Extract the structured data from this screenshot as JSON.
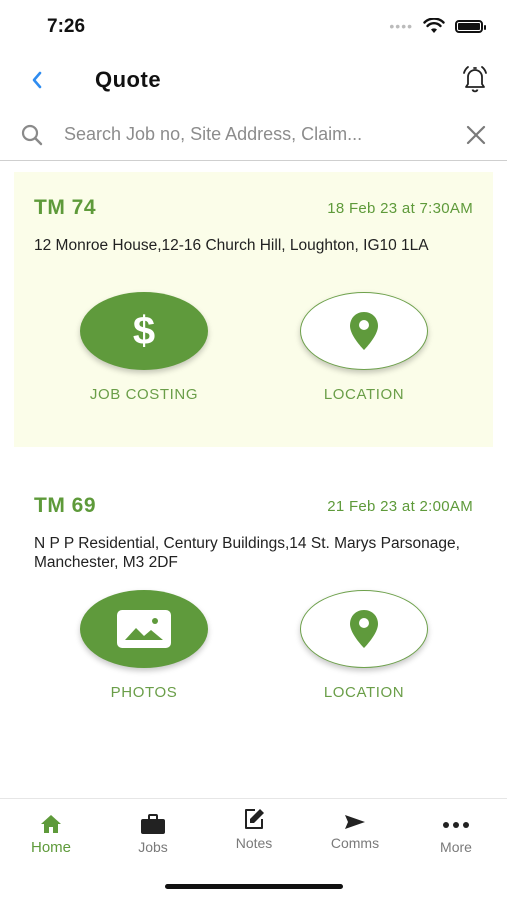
{
  "status_bar": {
    "time": "7:26"
  },
  "header": {
    "title": "Quote"
  },
  "search": {
    "placeholder": "Search Job no, Site Address, Claim..."
  },
  "jobs": [
    {
      "job_no": "TM 74",
      "date": "18 Feb 23 at 7:30AM",
      "address": "12 Monroe House,12-16 Church Hill, Loughton, IG10 1LA",
      "actions": [
        {
          "label": "JOB COSTING",
          "icon": "dollar-icon"
        },
        {
          "label": "LOCATION",
          "icon": "location-pin-icon"
        }
      ]
    },
    {
      "job_no": "TM 69",
      "date": "21 Feb 23 at 2:00AM",
      "address": "N P P Residential, Century Buildings,14 St. Marys Parsonage, Manchester, M3 2DF",
      "actions": [
        {
          "label": "PHOTOS",
          "icon": "photo-icon"
        },
        {
          "label": "LOCATION",
          "icon": "location-pin-icon"
        }
      ]
    }
  ],
  "tabs": [
    {
      "label": "Home",
      "icon": "home-icon",
      "active": true
    },
    {
      "label": "Jobs",
      "icon": "briefcase-icon",
      "active": false
    },
    {
      "label": "Notes",
      "icon": "edit-note-icon",
      "active": false
    },
    {
      "label": "Comms",
      "icon": "send-icon",
      "active": false
    },
    {
      "label": "More",
      "icon": "more-dots-icon",
      "active": false
    }
  ],
  "colors": {
    "accent_green": "#5f9a3c",
    "highlight_bg": "#fbfde9",
    "back_blue": "#2f8cf0"
  }
}
